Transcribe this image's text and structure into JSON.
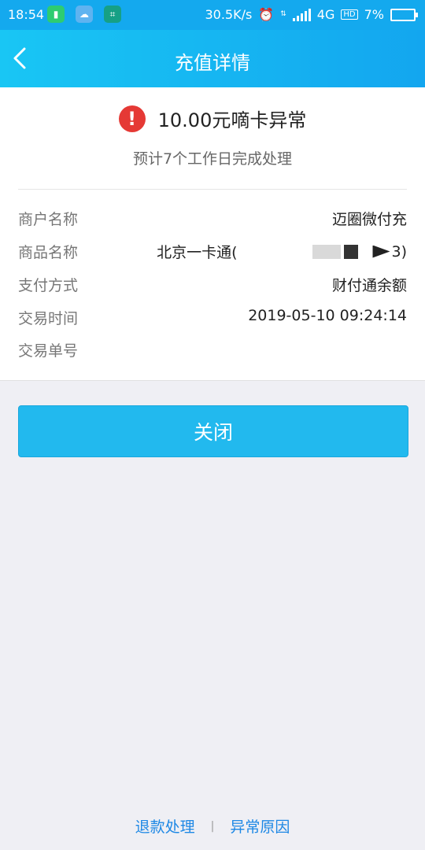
{
  "status_bar": {
    "time": "18:54",
    "network_speed": "30.5K/s",
    "network_type": "4G",
    "hd_badge": "HD",
    "battery_percent": "7%"
  },
  "header": {
    "title": "充值详情",
    "back_icon": "chevron-left-icon"
  },
  "summary": {
    "status_icon": "exclamation-icon",
    "status_text": "10.00元嘀卡异常",
    "sub_text": "预计7个工作日完成处理"
  },
  "details": [
    {
      "label": "商户名称",
      "value": "迈圈微付充"
    },
    {
      "label": "商品名称",
      "value_start": "北京一卡通(",
      "value_end": "3)"
    },
    {
      "label": "支付方式",
      "value": "财付通余额"
    },
    {
      "label": "交易时间",
      "value": "2019-05-10 09:24:14"
    },
    {
      "label": "交易单号",
      "value": ""
    }
  ],
  "actions": {
    "close_label": "关闭"
  },
  "footer": {
    "refund_link": "退款处理",
    "separator": "|",
    "reason_link": "异常原因"
  },
  "colors": {
    "header_blue": "#14a9ee",
    "button_blue": "#22b9ee",
    "link_blue": "#1e88e5",
    "alert_red": "#e53935"
  }
}
